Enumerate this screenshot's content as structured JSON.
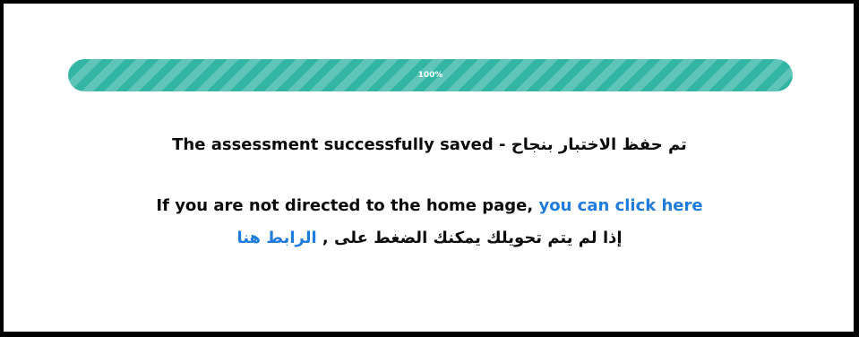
{
  "progress": {
    "value_percent": 100,
    "label": "100%",
    "color": "#33b5a5"
  },
  "messages": {
    "saved": "The assessment successfully saved - تم حفظ الاختبار بنجاح",
    "redirect_text_en": "If you are not directed to the home page, ",
    "redirect_link_en": "you can click here",
    "redirect_text_ar": "إذا لم يتم تحويلك يمكنك الضغط على , ",
    "redirect_link_ar": "الرابط هنا"
  },
  "colors": {
    "link": "#1f7bdc",
    "text": "#0b0b0b",
    "frame": "#000000"
  }
}
